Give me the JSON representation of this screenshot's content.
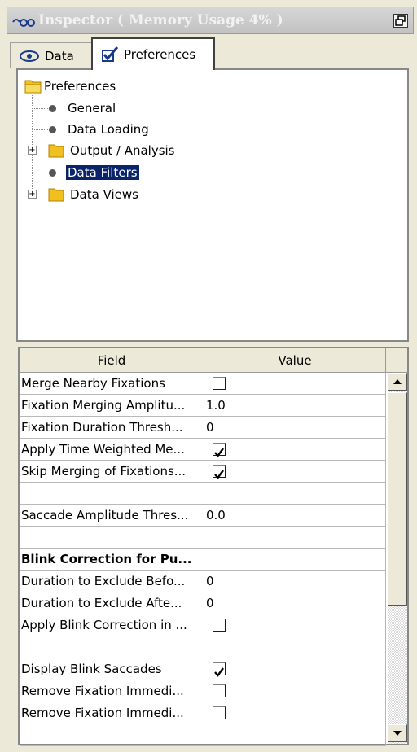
{
  "window": {
    "title": "Inspector ( Memory Usage 4% )",
    "title_icon": "eye-glasses-icon",
    "restore_icon": "restore-window-icon"
  },
  "tabs": [
    {
      "label": "Data",
      "icon": "eye-icon",
      "active": false
    },
    {
      "label": "Preferences",
      "icon": "checkbox-checked-icon",
      "active": true
    }
  ],
  "tree": {
    "root": "Preferences",
    "items": [
      {
        "label": "General",
        "type": "leaf"
      },
      {
        "label": "Data Loading",
        "type": "leaf"
      },
      {
        "label": "Output / Analysis",
        "type": "folder",
        "expander": "+"
      },
      {
        "label": "Data Filters",
        "type": "leaf",
        "selected": true
      },
      {
        "label": "Data Views",
        "type": "folder",
        "expander": "+"
      }
    ]
  },
  "table": {
    "columns": [
      "Field",
      "Value"
    ],
    "rows": [
      {
        "field": "Merge Nearby Fixations",
        "value": "",
        "checkbox": true,
        "checked": false
      },
      {
        "field": "Fixation Merging Amplitu...",
        "value": "1.0"
      },
      {
        "field": "Fixation Duration Thresh...",
        "value": "0"
      },
      {
        "field": "Apply Time Weighted Me...",
        "value": "",
        "checkbox": true,
        "checked": true
      },
      {
        "field": "Skip Merging of Fixations...",
        "value": "",
        "checkbox": true,
        "checked": true
      },
      {
        "field": "",
        "value": ""
      },
      {
        "field": "Saccade Amplitude Thres...",
        "value": "0.0"
      },
      {
        "field": "",
        "value": ""
      },
      {
        "field": "Blink Correction for Pu...",
        "value": "",
        "bold": true
      },
      {
        "field": "Duration to Exclude Befo...",
        "value": "0"
      },
      {
        "field": "Duration to Exclude Afte...",
        "value": "0"
      },
      {
        "field": "Apply Blink Correction in ...",
        "value": "",
        "checkbox": true,
        "checked": false
      },
      {
        "field": "",
        "value": ""
      },
      {
        "field": "Display Blink Saccades",
        "value": "",
        "checkbox": true,
        "checked": true
      },
      {
        "field": "Remove Fixation Immedi...",
        "value": "",
        "checkbox": true,
        "checked": false
      },
      {
        "field": "Remove Fixation Immedi...",
        "value": "",
        "checkbox": true,
        "checked": false
      },
      {
        "field": "",
        "value": ""
      }
    ]
  },
  "scrollbar": {
    "up_icon": "scroll-up-arrow-icon",
    "down_icon": "scroll-down-arrow-icon"
  },
  "colors": {
    "selection": "#0a246a",
    "folder": "#f0c020",
    "title_bg": "#c8c8c8"
  }
}
